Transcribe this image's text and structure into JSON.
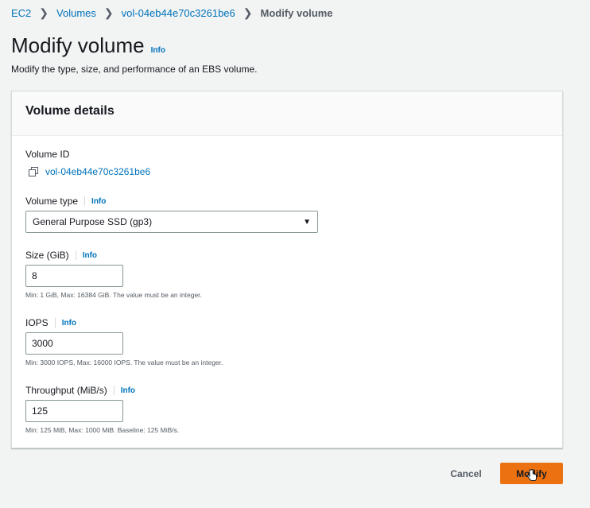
{
  "breadcrumb": {
    "items": [
      "EC2",
      "Volumes",
      "vol-04eb44e70c3261be6"
    ],
    "current": "Modify volume"
  },
  "page": {
    "title": "Modify volume",
    "info": "Info",
    "description": "Modify the type, size, and performance of an EBS volume."
  },
  "panel": {
    "title": "Volume details",
    "volume_id_label": "Volume ID",
    "volume_id": "vol-04eb44e70c3261be6",
    "volume_type_label": "Volume type",
    "volume_type_info": "Info",
    "volume_type_value": "General Purpose SSD (gp3)",
    "size_label": "Size (GiB)",
    "size_info": "Info",
    "size_value": "8",
    "size_hint": "Min: 1 GiB, Max: 16384 GiB. The value must be an integer.",
    "iops_label": "IOPS",
    "iops_info": "Info",
    "iops_value": "3000",
    "iops_hint": "Min: 3000 IOPS, Max: 16000 IOPS. The value must be an integer.",
    "throughput_label": "Throughput (MiB/s)",
    "throughput_info": "Info",
    "throughput_value": "125",
    "throughput_hint": "Min: 125 MiB, Max: 1000 MiB. Baseline: 125 MiB/s."
  },
  "actions": {
    "cancel": "Cancel",
    "modify": "Modify"
  },
  "colors": {
    "link": "#0073bb",
    "primary_button": "#ec7211",
    "background": "#f2f3f3"
  },
  "icons": [
    "chevron-right-icon",
    "copy-icon",
    "caret-down-icon",
    "hand-pointer-cursor-icon"
  ]
}
